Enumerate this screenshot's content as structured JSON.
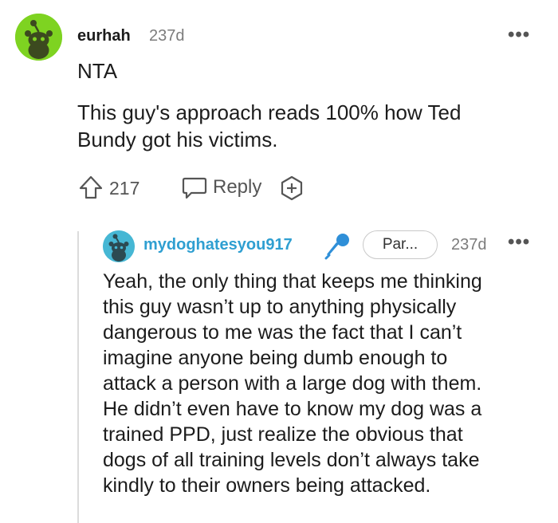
{
  "comment": {
    "username": "eurhah",
    "age": "237d",
    "more": "•••",
    "body_line1": "NTA",
    "body_para": "This guy's approach reads 100% how Ted Bundy got his victims.",
    "vote_count": "217",
    "reply_label": "Reply",
    "avatar_color": "#7ed321",
    "upvote_icon": "upvote-arrow-icon",
    "reply_icon": "chat-bubble-icon",
    "award_icon": "award-plus-icon"
  },
  "reply": {
    "username": "mydoghatesyou917",
    "flair": "Par...",
    "age": "237d",
    "more": "•••",
    "avatar_color": "#46b7d4",
    "mic_icon": "microphone-icon",
    "body_lines": [
      "Yeah, the only thing that keeps me thinking",
      "this guy wasn’t up to anything physically",
      "dangerous to me was the fact that I can’t",
      "imagine anyone being dumb enough to",
      "attack a person with a large dog with them.",
      "He didn’t even have to know my dog was a",
      "trained PPD, just realize the obvious that",
      "dogs of all training levels don’t always take",
      "kindly to their owners being attacked."
    ]
  }
}
